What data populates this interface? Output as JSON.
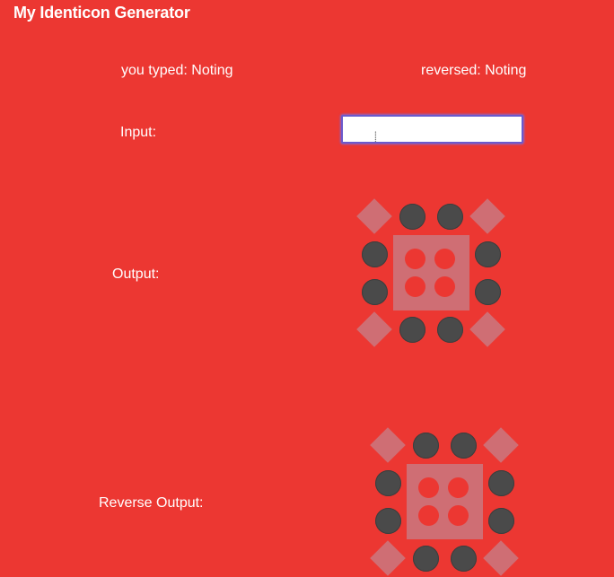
{
  "app": {
    "title": "My Identicon Generator"
  },
  "labels": {
    "typed": "you typed: Noting",
    "reversed": "reversed: Noting",
    "input": "Input:",
    "output": "Output:",
    "reverse_output": "Reverse Output:"
  },
  "input": {
    "value": "",
    "cursor_glyph": "⸽"
  },
  "colors": {
    "background": "#ec3732",
    "shape_light": "#cf6e74",
    "shape_dark": "#4a4a4a"
  },
  "icons": {
    "output": "identicon-output",
    "reverse_output": "identicon-reverse-output"
  }
}
